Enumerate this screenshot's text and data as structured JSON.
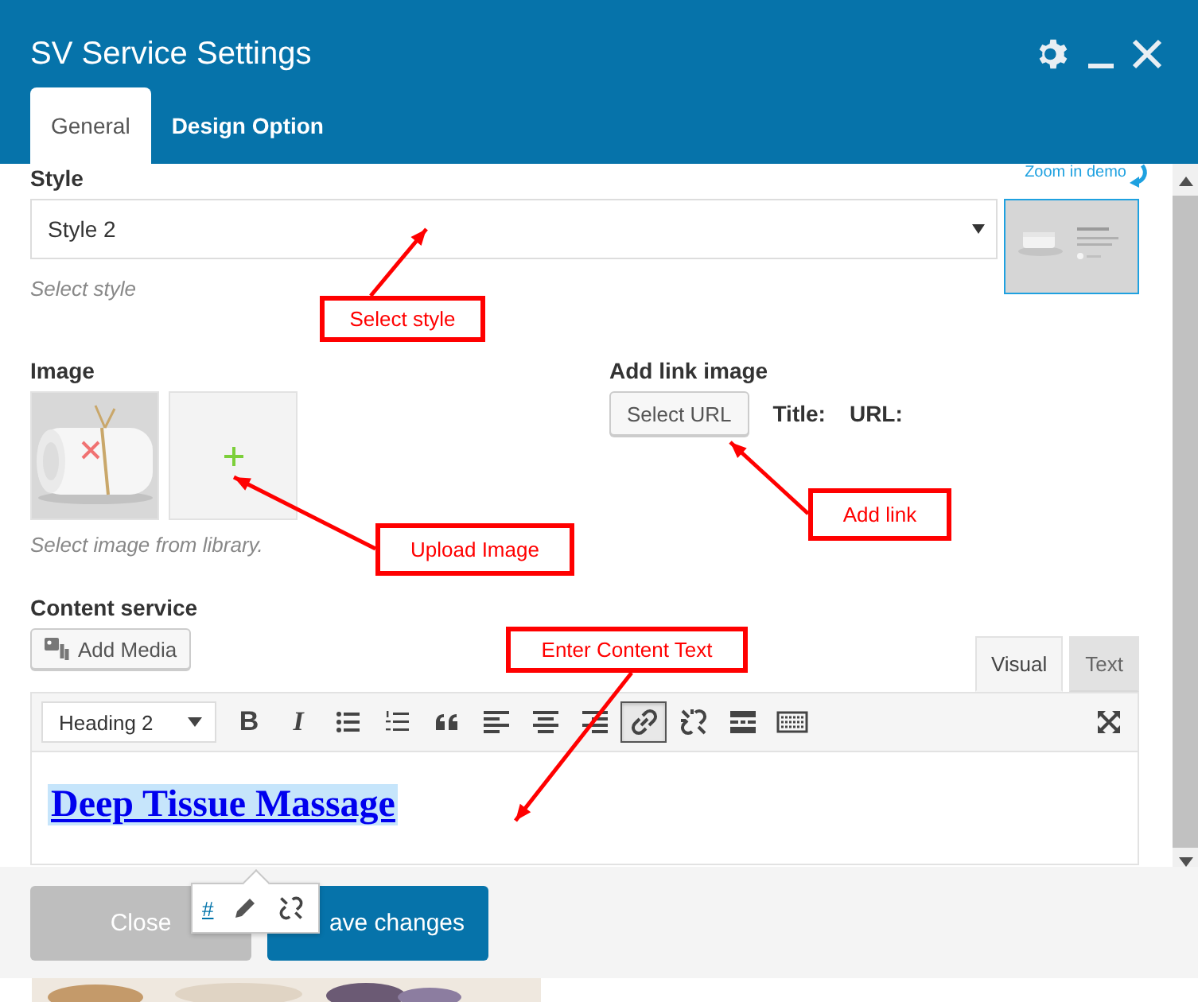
{
  "window": {
    "title": "SV Service Settings"
  },
  "tabs": [
    {
      "label": "General",
      "selected": true
    },
    {
      "label": "Design Option",
      "selected": false
    }
  ],
  "style_field": {
    "label": "Style",
    "value": "Style 2",
    "hint": "Select style",
    "preview_link": "Zoom in demo"
  },
  "image_field": {
    "label": "Image",
    "hint": "Select image from library."
  },
  "link_field": {
    "label": "Add link image",
    "button": "Select URL",
    "title_label": "Title:",
    "url_label": "URL:"
  },
  "content_field": {
    "label": "Content service",
    "add_media": "Add Media",
    "format": "Heading 2",
    "heading": "Deep Tissue Massage",
    "editor_tabs": [
      {
        "label": "Visual",
        "selected": true
      },
      {
        "label": "Text",
        "selected": false
      }
    ],
    "toolbar": [
      {
        "kind": "bold",
        "label": "B",
        "active": false
      },
      {
        "kind": "italic",
        "label": "I",
        "active": false
      },
      {
        "kind": "bullets",
        "active": false
      },
      {
        "kind": "numbers",
        "active": false
      },
      {
        "kind": "quote",
        "active": false
      },
      {
        "kind": "align-left",
        "active": false
      },
      {
        "kind": "align-center",
        "active": false
      },
      {
        "kind": "align-right",
        "active": false
      },
      {
        "kind": "link",
        "active": true
      },
      {
        "kind": "unlink",
        "active": false
      },
      {
        "kind": "more",
        "active": false
      },
      {
        "kind": "keyboard",
        "active": false
      }
    ]
  },
  "link_popup": {
    "url": "#"
  },
  "buttons": [
    {
      "label": "Close",
      "kind": "secondary"
    },
    {
      "label": "ave changes",
      "kind": "primary"
    }
  ],
  "annotations": [
    {
      "text": "Select style"
    },
    {
      "text": "Upload Image"
    },
    {
      "text": "Add link"
    },
    {
      "text": "Enter Content Text"
    }
  ]
}
